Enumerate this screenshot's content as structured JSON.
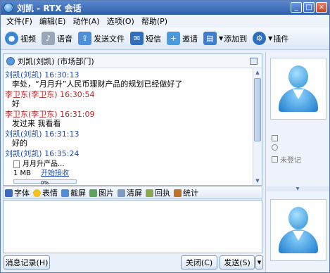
{
  "window": {
    "title": "刘凯 - RTX 会话",
    "controls": [
      "_",
      "□",
      "×"
    ]
  },
  "menu": [
    "文件(F)",
    "编辑(E)",
    "动作(A)",
    "选项(O)",
    "帮助(P)"
  ],
  "toolbar": {
    "video": "视频",
    "voice": "语音",
    "send_file": "发送文件",
    "sms": "短信",
    "invite": "邀请",
    "add_to": "添加到",
    "plugin": "插件"
  },
  "chat": {
    "contact": "刘凯(刘凯) (市场部门)",
    "messages": [
      {
        "sender": "刘凯(刘凯)",
        "time": "16:30:13",
        "text": "李处，“月月升”人民币理财产品的规划已经做好了"
      },
      {
        "sender": "李卫东(李卫东)",
        "time": "16:30:54",
        "text": "好"
      },
      {
        "sender": "李卫东(李卫东)",
        "time": "16:31:09",
        "text": "发过来 我看看"
      },
      {
        "sender": "刘凯(刘凯)",
        "time": "16:31:13",
        "text": "好的"
      },
      {
        "sender": "刘凯(刘凯)",
        "time": "16:35:24",
        "text": ""
      }
    ],
    "file": {
      "name": "月月升产品...",
      "size": "1 MB",
      "accept": "开始接收",
      "progress_label": "0%",
      "progress": 0
    }
  },
  "format_bar": [
    "字体",
    "表情",
    "截屏",
    "图片",
    "清屏",
    "回执",
    "统计"
  ],
  "buttons": {
    "history": "消息记录(H)",
    "close": "关闭(C)",
    "send": "发送(S)"
  },
  "side": {
    "status": "未登记"
  }
}
